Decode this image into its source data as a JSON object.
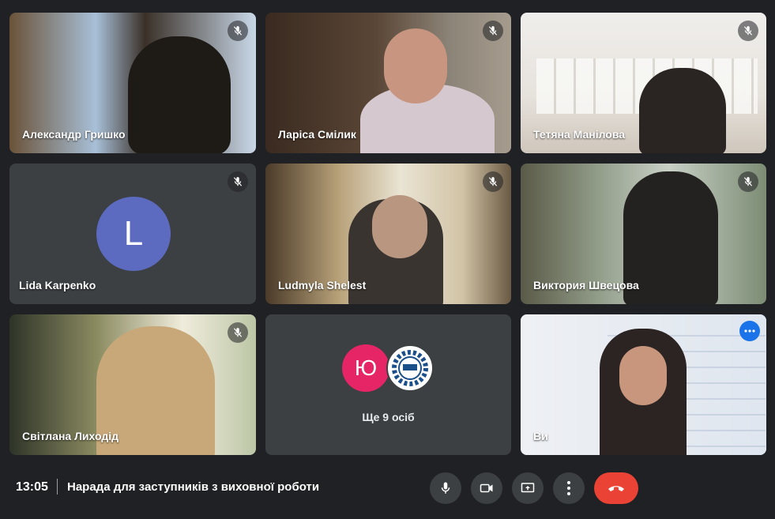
{
  "participants": [
    {
      "name": "Александр Гришко"
    },
    {
      "name": "Ларіса Смілик"
    },
    {
      "name": "Тетяна Манілова"
    },
    {
      "name": "Lida Karpenko",
      "avatar_letter": "L"
    },
    {
      "name": "Ludmyla Shelest"
    },
    {
      "name": "Виктория Швецова"
    },
    {
      "name": "Світлана Лиходід"
    }
  ],
  "others": {
    "avatar_letter": "Ю",
    "label": "Ще 9 осіб"
  },
  "self": {
    "name": "Ви"
  },
  "bottom_bar": {
    "time": "13:05",
    "meeting_title": "Нарада для заступників з виховної роботи"
  },
  "colors": {
    "hangup": "#ea4335",
    "avatar": "#5c6bc0",
    "others_avatar": "#e52566",
    "accent": "#1a73e8"
  }
}
